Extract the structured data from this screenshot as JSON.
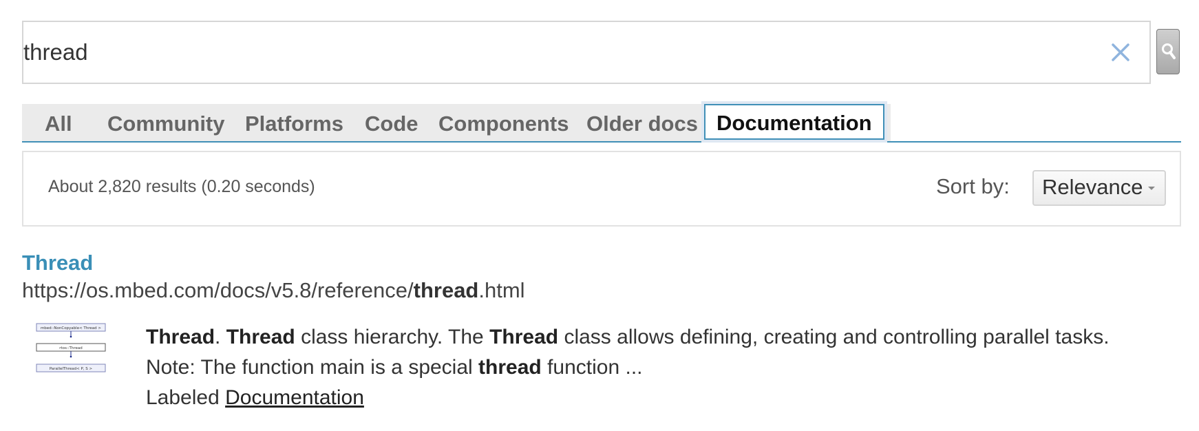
{
  "search": {
    "query": "thread",
    "clear_icon": "close-icon",
    "submit_icon": "search-icon"
  },
  "tabs": [
    {
      "label": "All",
      "active": false
    },
    {
      "label": "Community",
      "active": false
    },
    {
      "label": "Platforms",
      "active": false
    },
    {
      "label": "Code",
      "active": false
    },
    {
      "label": "Components",
      "active": false
    },
    {
      "label": "Older docs",
      "active": false
    },
    {
      "label": "Documentation",
      "active": true
    }
  ],
  "results_info": {
    "count_text": "About 2,820 results (0.20 seconds)",
    "sort_label": "Sort by:",
    "sort_value": "Relevance"
  },
  "result": {
    "title": "Thread",
    "url_prefix": "https://os.mbed.com/docs/v5.8/reference/",
    "url_bold": "thread",
    "url_suffix": ".html",
    "thumbnail": {
      "box1": "mbed::NonCopyable< Thread >",
      "box2": "rtos::Thread",
      "box3": "ParallelThread< P, S >"
    },
    "snippet": {
      "b1": "Thread",
      "t1": ". ",
      "b2": "Thread",
      "t2": " class hierarchy. The ",
      "b3": "Thread",
      "t3": " class allows defining, creating and controlling parallel tasks.",
      "line2_a": "Note: The function main is a special ",
      "line2_b": "thread",
      "line2_c": " function ...",
      "labeled_prefix": "Labeled ",
      "labeled_link": "Documentation"
    }
  },
  "colors": {
    "accent": "#3f8fb7",
    "tab_bg": "#ebebeb",
    "link": "#3a8fb7"
  }
}
